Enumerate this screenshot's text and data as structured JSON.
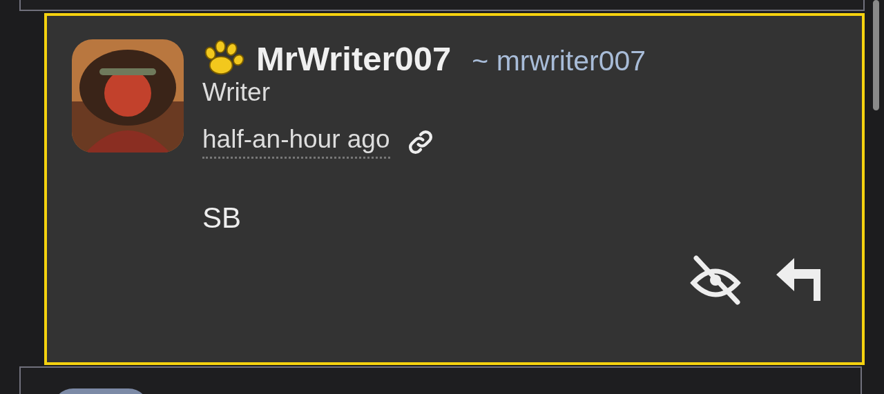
{
  "comment": {
    "author": {
      "name": "MrWriter007",
      "handle": "~ mrwriter007",
      "title": "Writer"
    },
    "time": "half-an-hour ago",
    "body": "SB",
    "highlighted": true
  }
}
